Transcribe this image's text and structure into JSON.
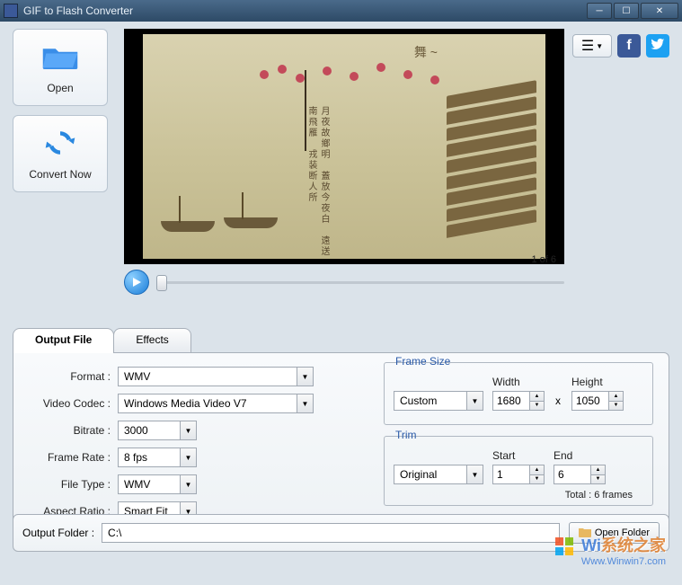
{
  "window": {
    "title": "GIF to Flash Converter"
  },
  "buttons": {
    "open": "Open",
    "convert": "Convert Now",
    "open_folder": "Open Folder"
  },
  "preview": {
    "page_text": "1 of 6"
  },
  "tabs": {
    "output": "Output File",
    "effects": "Effects"
  },
  "labels": {
    "format": "Format :",
    "video_codec": "Video Codec :",
    "bitrate": "Bitrate :",
    "frame_rate": "Frame Rate :",
    "file_type": "File Type :",
    "aspect_ratio": "Aspect Ratio :",
    "output_folder": "Output Folder :",
    "width": "Width",
    "height": "Height",
    "start": "Start",
    "end": "End"
  },
  "values": {
    "format": "WMV",
    "video_codec": "Windows Media Video V7",
    "bitrate": "3000",
    "frame_rate": "8 fps",
    "file_type": "WMV",
    "aspect_ratio": "Smart Fit",
    "frame_size_mode": "Custom",
    "width": "1680",
    "height": "1050",
    "trim_mode": "Original",
    "start": "1",
    "end": "6",
    "output_folder": "C:\\"
  },
  "groups": {
    "frame_size": "Frame Size",
    "trim": "Trim",
    "total_frames": "Total : 6 frames"
  },
  "watermark": {
    "line1a": "Wi",
    "line1b": "系统之家",
    "line2": "Www.Winwin7.com"
  }
}
